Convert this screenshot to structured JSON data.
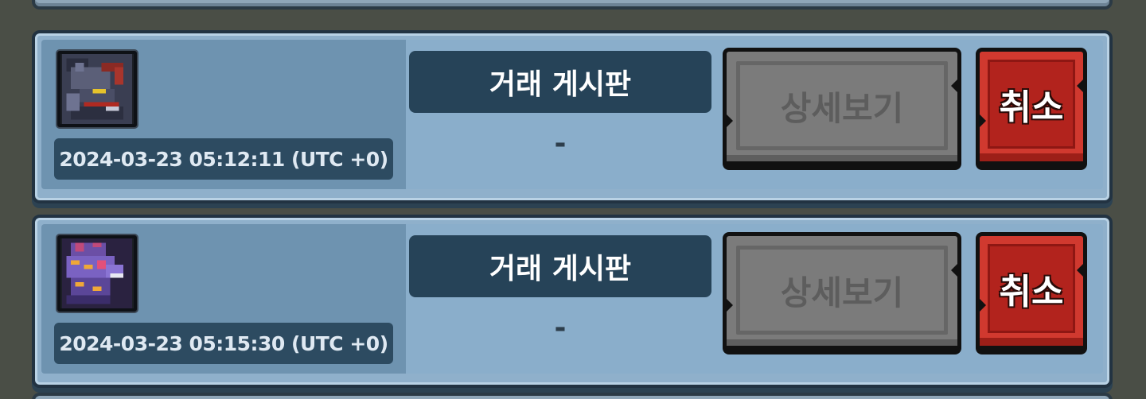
{
  "listings": [
    {
      "avatar_icon": "dark-monster-icon",
      "timestamp": "2024-03-23 05:12:11 (UTC +0)",
      "source_label": "거래 게시판",
      "sub_value": "-",
      "detail_label": "상세보기",
      "cancel_label": "취소"
    },
    {
      "avatar_icon": "purple-dragon-icon",
      "timestamp": "2024-03-23 05:15:30 (UTC +0)",
      "source_label": "거래 게시판",
      "sub_value": "-",
      "detail_label": "상세보기",
      "cancel_label": "취소"
    }
  ],
  "colors": {
    "card_bg": "#8fb0cb",
    "card_left": "#6e93b0",
    "label_bg": "#264358",
    "detail_button": "#7b7b7b",
    "cancel_button": "#d0392f"
  }
}
